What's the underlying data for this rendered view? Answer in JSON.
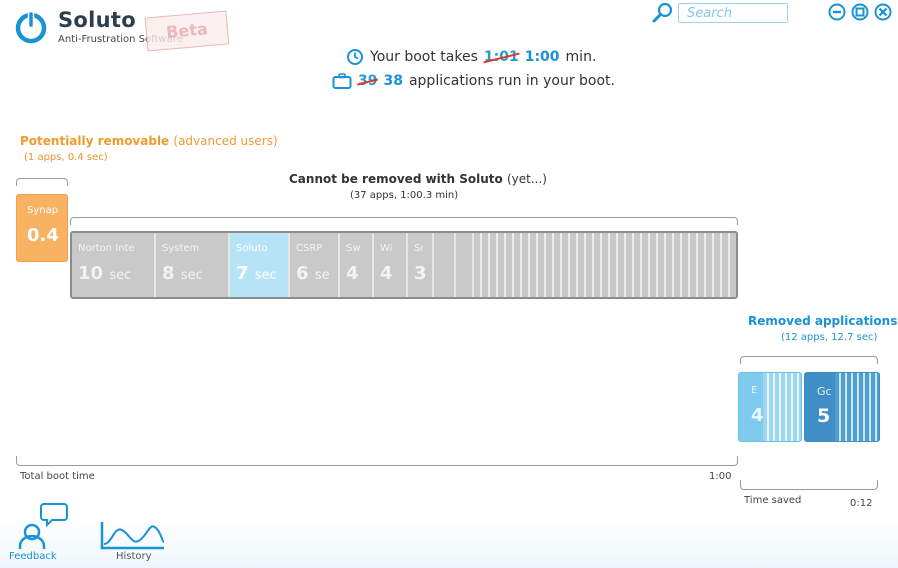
{
  "app": {
    "title": "Soluto",
    "subtitle": "Anti-Frustration Software",
    "badge": "Beta"
  },
  "search": {
    "placeholder": "Search"
  },
  "boot": {
    "line1_prefix": "Your boot takes",
    "line1_old": "1:01",
    "line1_new": "1:00",
    "line1_suffix": "min.",
    "line2_old": "39",
    "line2_new": "38",
    "line2_suffix": "applications run in your boot."
  },
  "potential": {
    "title": "Potentially removable",
    "title_note": "(advanced users)",
    "summary": "(1 apps, 0.4 sec)",
    "app": {
      "name": "Synap",
      "sec": "0.4"
    }
  },
  "cannot": {
    "title": "Cannot be removed with Soluto",
    "title_note": "(yet...)",
    "summary": "(37 apps, 1:00.3 min)",
    "apps": [
      {
        "name": "Norton Inte",
        "sec": "10",
        "unit": "sec"
      },
      {
        "name": "System",
        "sec": "8",
        "unit": "sec"
      },
      {
        "name": "Soluto",
        "sec": "7",
        "unit": "sec"
      },
      {
        "name": "CSRP",
        "sec": "6",
        "unit": "se"
      },
      {
        "name": "Sw",
        "sec": "4",
        "unit": ""
      },
      {
        "name": "Wi",
        "sec": "4",
        "unit": ""
      },
      {
        "name": "Sı",
        "sec": "3",
        "unit": ""
      }
    ]
  },
  "removed": {
    "title": "Removed applications",
    "summary": "(12 apps, 12.7 sec)",
    "apps": [
      {
        "name": "E",
        "sec": "4"
      },
      {
        "name": "Gc",
        "sec": "5"
      }
    ]
  },
  "timeline": {
    "total_label": "Total boot time",
    "total_value": "1:00",
    "saved_label": "Time saved",
    "saved_value": "0:12"
  },
  "nav": {
    "feedback": "Feedback",
    "history": "History"
  },
  "colors": {
    "accent": "#1a92d6",
    "orange": "#f09b2c",
    "strike": "#d93b2b"
  }
}
